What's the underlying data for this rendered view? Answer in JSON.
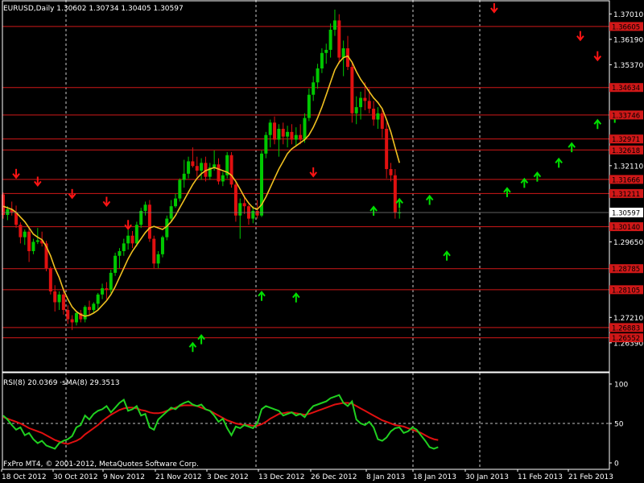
{
  "colors": {
    "background": "#000000",
    "frame": "#ffffff",
    "grid": "#ffffff",
    "bull": "#00c800",
    "bear": "#e01010",
    "ma": "#f0c020",
    "level": "#d01818",
    "up_arrow": "#00e000",
    "down_arrow": "#ff1414",
    "rsi": "#20d020",
    "rsi_ma": "#e01010"
  },
  "header": {
    "title": "EURUSD,Daily  1.30602 1.30734 1.30405 1.30597",
    "indicator": "RSI(8) 20.0369  ·sMA(8) 29.3513"
  },
  "footer": {
    "copyright": "FxPro MT4, © 2001-2012, MetaQuotes Software Corp."
  },
  "chart_data": [
    {
      "type": "candlestick",
      "title": "EURUSD,Daily  1.30602 1.30734 1.30405 1.30597",
      "xlabel": "",
      "ylabel": "",
      "ylim": [
        1.2545,
        1.3746
      ],
      "price_ticks": [
        "1.37010",
        "1.36190",
        "1.35370",
        "1.32930",
        "1.32110",
        "1.29650",
        "1.27210",
        "1.26390"
      ],
      "last_price": "1.30597",
      "levels": [
        "1.36605",
        "1.34634",
        "1.33746",
        "1.32971",
        "1.32618",
        "1.31666",
        "1.31211",
        "1.30140",
        "1.28785",
        "1.28105",
        "1.26883",
        "1.26552"
      ],
      "date_labels": [
        "18 Oct 2012",
        "30 Oct 2012",
        "9 Nov 2012",
        "21 Nov 2012",
        "3 Dec 2012",
        "13 Dec 2012",
        "26 Dec 2012",
        "8 Jan 2013",
        "18 Jan 2013",
        "30 Jan 2013",
        "11 Feb 2013",
        "21 Feb 2013"
      ],
      "candles": [
        [
          1.3118,
          1.3124,
          1.304,
          1.3052
        ],
        [
          1.3052,
          1.308,
          1.3035,
          1.307
        ],
        [
          1.307,
          1.3095,
          1.305,
          1.306
        ],
        [
          1.306,
          1.3082,
          1.301,
          1.302
        ],
        [
          1.302,
          1.3028,
          1.296,
          1.298
        ],
        [
          1.298,
          1.3005,
          1.2955,
          1.2998
        ],
        [
          1.2998,
          1.301,
          1.29,
          1.2935
        ],
        [
          1.2935,
          1.2975,
          1.2925,
          1.2965
        ],
        [
          1.2965,
          1.301,
          1.2958,
          1.297
        ],
        [
          1.297,
          1.2998,
          1.295,
          1.296
        ],
        [
          1.296,
          1.2968,
          1.287,
          1.288
        ],
        [
          1.288,
          1.2885,
          1.2795,
          1.2805
        ],
        [
          1.2805,
          1.2825,
          1.274,
          1.277
        ],
        [
          1.277,
          1.2805,
          1.2745,
          1.2795
        ],
        [
          1.2795,
          1.2815,
          1.273,
          1.2745
        ],
        [
          1.2745,
          1.276,
          1.27,
          1.2715
        ],
        [
          1.2715,
          1.2728,
          1.268,
          1.2705
        ],
        [
          1.2705,
          1.274,
          1.2695,
          1.2735
        ],
        [
          1.2735,
          1.2745,
          1.2705,
          1.2715
        ],
        [
          1.2715,
          1.276,
          1.2705,
          1.2755
        ],
        [
          1.2755,
          1.2775,
          1.273,
          1.2745
        ],
        [
          1.2745,
          1.277,
          1.2735,
          1.2765
        ],
        [
          1.2765,
          1.28,
          1.2745,
          1.2795
        ],
        [
          1.2795,
          1.283,
          1.278,
          1.2815
        ],
        [
          1.2815,
          1.2835,
          1.278,
          1.281
        ],
        [
          1.281,
          1.2875,
          1.28,
          1.2865
        ],
        [
          1.2865,
          1.293,
          1.2855,
          1.292
        ],
        [
          1.292,
          1.2945,
          1.288,
          1.2935
        ],
        [
          1.2935,
          1.2975,
          1.292,
          1.296
        ],
        [
          1.296,
          1.3005,
          1.294,
          1.2985
        ],
        [
          1.2985,
          1.3,
          1.2945,
          1.296
        ],
        [
          1.296,
          1.303,
          1.295,
          1.302
        ],
        [
          1.302,
          1.3075,
          1.301,
          1.3065
        ],
        [
          1.3065,
          1.3095,
          1.305,
          1.3085
        ],
        [
          1.3085,
          1.31,
          1.2965,
          1.2975
        ],
        [
          1.2975,
          1.2985,
          1.288,
          1.2895
        ],
        [
          1.2895,
          1.2935,
          1.288,
          1.2925
        ],
        [
          1.2925,
          1.2985,
          1.2915,
          1.298
        ],
        [
          1.298,
          1.305,
          1.297,
          1.304
        ],
        [
          1.304,
          1.31,
          1.303,
          1.308
        ],
        [
          1.308,
          1.312,
          1.3075,
          1.3105
        ],
        [
          1.3105,
          1.317,
          1.3095,
          1.3165
        ],
        [
          1.3165,
          1.323,
          1.314,
          1.3185
        ],
        [
          1.3185,
          1.324,
          1.317,
          1.3225
        ],
        [
          1.3225,
          1.327,
          1.3205,
          1.321
        ],
        [
          1.321,
          1.324,
          1.3175,
          1.3195
        ],
        [
          1.3195,
          1.3235,
          1.3165,
          1.322
        ],
        [
          1.322,
          1.324,
          1.316,
          1.3175
        ],
        [
          1.3175,
          1.322,
          1.3165,
          1.3205
        ],
        [
          1.3205,
          1.326,
          1.3195,
          1.3215
        ],
        [
          1.3215,
          1.3235,
          1.315,
          1.316
        ],
        [
          1.316,
          1.319,
          1.3145,
          1.318
        ],
        [
          1.318,
          1.3255,
          1.317,
          1.3245
        ],
        [
          1.3245,
          1.3255,
          1.314,
          1.315
        ],
        [
          1.315,
          1.316,
          1.303,
          1.305
        ],
        [
          1.305,
          1.3105,
          1.2975,
          1.309
        ],
        [
          1.309,
          1.3115,
          1.3055,
          1.308
        ],
        [
          1.308,
          1.3085,
          1.302,
          1.304
        ],
        [
          1.304,
          1.308,
          1.3025,
          1.3065
        ],
        [
          1.3065,
          1.31,
          1.304,
          1.305
        ],
        [
          1.305,
          1.326,
          1.3045,
          1.325
        ],
        [
          1.325,
          1.332,
          1.3235,
          1.331
        ],
        [
          1.331,
          1.336,
          1.327,
          1.335
        ],
        [
          1.335,
          1.337,
          1.328,
          1.3295
        ],
        [
          1.3295,
          1.3345,
          1.324,
          1.333
        ],
        [
          1.333,
          1.335,
          1.328,
          1.3305
        ],
        [
          1.3305,
          1.334,
          1.327,
          1.332
        ],
        [
          1.332,
          1.3345,
          1.328,
          1.3295
        ],
        [
          1.3295,
          1.3335,
          1.3275,
          1.331
        ],
        [
          1.331,
          1.3345,
          1.328,
          1.3295
        ],
        [
          1.3295,
          1.338,
          1.3285,
          1.3365
        ],
        [
          1.3365,
          1.346,
          1.3355,
          1.344
        ],
        [
          1.344,
          1.35,
          1.342,
          1.348
        ],
        [
          1.348,
          1.354,
          1.346,
          1.3525
        ],
        [
          1.3525,
          1.359,
          1.351,
          1.3575
        ],
        [
          1.3575,
          1.3605,
          1.354,
          1.3585
        ],
        [
          1.3585,
          1.367,
          1.356,
          1.365
        ],
        [
          1.365,
          1.3715,
          1.363,
          1.368
        ],
        [
          1.368,
          1.37,
          1.354,
          1.356
        ],
        [
          1.356,
          1.3615,
          1.35,
          1.359
        ],
        [
          1.359,
          1.363,
          1.352,
          1.353
        ],
        [
          1.353,
          1.3545,
          1.335,
          1.338
        ],
        [
          1.338,
          1.3435,
          1.3345,
          1.34
        ],
        [
          1.34,
          1.345,
          1.336,
          1.343
        ],
        [
          1.343,
          1.348,
          1.339,
          1.342
        ],
        [
          1.342,
          1.346,
          1.338,
          1.3395
        ],
        [
          1.3395,
          1.342,
          1.334,
          1.336
        ],
        [
          1.336,
          1.34,
          1.333,
          1.338
        ],
        [
          1.338,
          1.3395,
          1.33,
          1.333
        ],
        [
          1.333,
          1.335,
          1.317,
          1.32
        ],
        [
          1.32,
          1.322,
          1.316,
          1.318
        ],
        [
          1.318,
          1.32,
          1.304,
          1.306
        ],
        [
          1.306,
          1.3073,
          1.304,
          1.306
        ]
      ],
      "ma": [
        1.308,
        1.3075,
        1.307,
        1.306,
        1.3045,
        1.303,
        1.301,
        1.299,
        1.298,
        1.2972,
        1.295,
        1.292,
        1.288,
        1.285,
        1.281,
        1.278,
        1.2755,
        1.274,
        1.273,
        1.2725,
        1.2728,
        1.2735,
        1.2745,
        1.276,
        1.2775,
        1.2795,
        1.282,
        1.285,
        1.288,
        1.291,
        1.2935,
        1.2955,
        1.2975,
        1.2995,
        1.301,
        1.3015,
        1.301,
        1.3005,
        1.3015,
        1.303,
        1.305,
        1.3075,
        1.31,
        1.3125,
        1.315,
        1.317,
        1.3185,
        1.3195,
        1.32,
        1.3205,
        1.32,
        1.3195,
        1.319,
        1.318,
        1.316,
        1.3135,
        1.311,
        1.309,
        1.3075,
        1.307,
        1.3085,
        1.311,
        1.314,
        1.317,
        1.32,
        1.3225,
        1.325,
        1.3265,
        1.3275,
        1.3285,
        1.3295,
        1.331,
        1.3335,
        1.3365,
        1.34,
        1.344,
        1.348,
        1.352,
        1.3545,
        1.356,
        1.3565,
        1.3545,
        1.3515,
        1.349,
        1.347,
        1.345,
        1.343,
        1.3415,
        1.3395,
        1.336,
        1.332,
        1.327,
        1.322
      ],
      "signals": {
        "down": [
          [
            3,
            1.3185
          ],
          [
            8,
            1.316
          ],
          [
            16,
            1.312
          ],
          [
            24,
            1.3095
          ],
          [
            29,
            1.302
          ],
          [
            72,
            1.319
          ],
          [
            114,
            1.372
          ],
          [
            134,
            1.363
          ],
          [
            138,
            1.3565
          ],
          [
            153,
            1.3455
          ],
          [
            157,
            1.3395
          ],
          [
            164,
            1.3255
          ]
        ],
        "up": [
          [
            44,
            1.2625
          ],
          [
            46,
            1.265
          ],
          [
            60,
            1.279
          ],
          [
            68,
            1.2785
          ],
          [
            86,
            1.3065
          ],
          [
            92,
            1.309
          ],
          [
            99,
            1.31
          ],
          [
            103,
            1.292
          ],
          [
            117,
            1.3125
          ],
          [
            121,
            1.3155
          ],
          [
            124,
            1.3175
          ],
          [
            129,
            1.322
          ],
          [
            132,
            1.327
          ],
          [
            138,
            1.3345
          ],
          [
            142,
            1.3365
          ]
        ]
      }
    },
    {
      "type": "line",
      "title": "RSI(8) 20.0369  ·sMA(8) 29.3513",
      "ylim": [
        0,
        100
      ],
      "y_ticks": [
        "100",
        "50",
        "0"
      ],
      "series": [
        {
          "name": "RSI(8)",
          "values": [
            60,
            55,
            48,
            42,
            45,
            35,
            38,
            30,
            25,
            28,
            22,
            20,
            18,
            25,
            28,
            30,
            34,
            45,
            48,
            60,
            55,
            62,
            66,
            68,
            72,
            64,
            70,
            76,
            80,
            66,
            68,
            72,
            60,
            62,
            45,
            42,
            55,
            60,
            65,
            70,
            68,
            73,
            76,
            78,
            74,
            72,
            74,
            68,
            66,
            60,
            52,
            56,
            44,
            35,
            46,
            44,
            48,
            46,
            44,
            50,
            68,
            72,
            70,
            68,
            66,
            60,
            62,
            64,
            60,
            62,
            58,
            66,
            72,
            74,
            76,
            78,
            82,
            84,
            86,
            76,
            72,
            78,
            55,
            50,
            48,
            52,
            45,
            30,
            28,
            32,
            40,
            44,
            45,
            38,
            40,
            45,
            42,
            35,
            28,
            20,
            18,
            20
          ]
        },
        {
          "name": "sMA(8)",
          "values": [
            58,
            56,
            54,
            52,
            50,
            47,
            44,
            42,
            40,
            38,
            35,
            32,
            29,
            27,
            25,
            24,
            26,
            28,
            31,
            36,
            40,
            44,
            48,
            53,
            57,
            61,
            64,
            67,
            69,
            70,
            70,
            69,
            67,
            66,
            64,
            63,
            63,
            64,
            66,
            68,
            70,
            72,
            73,
            73,
            73,
            72,
            70,
            68,
            66,
            63,
            60,
            57,
            54,
            52,
            50,
            49,
            48,
            48,
            47,
            47,
            49,
            52,
            56,
            59,
            62,
            63,
            64,
            64,
            63,
            62,
            61,
            62,
            64,
            66,
            68,
            70,
            72,
            74,
            75,
            76,
            76,
            75,
            72,
            69,
            66,
            63,
            60,
            57,
            54,
            52,
            50,
            48,
            47,
            46,
            44,
            42,
            40,
            38,
            35,
            32,
            30,
            29
          ]
        }
      ]
    }
  ]
}
